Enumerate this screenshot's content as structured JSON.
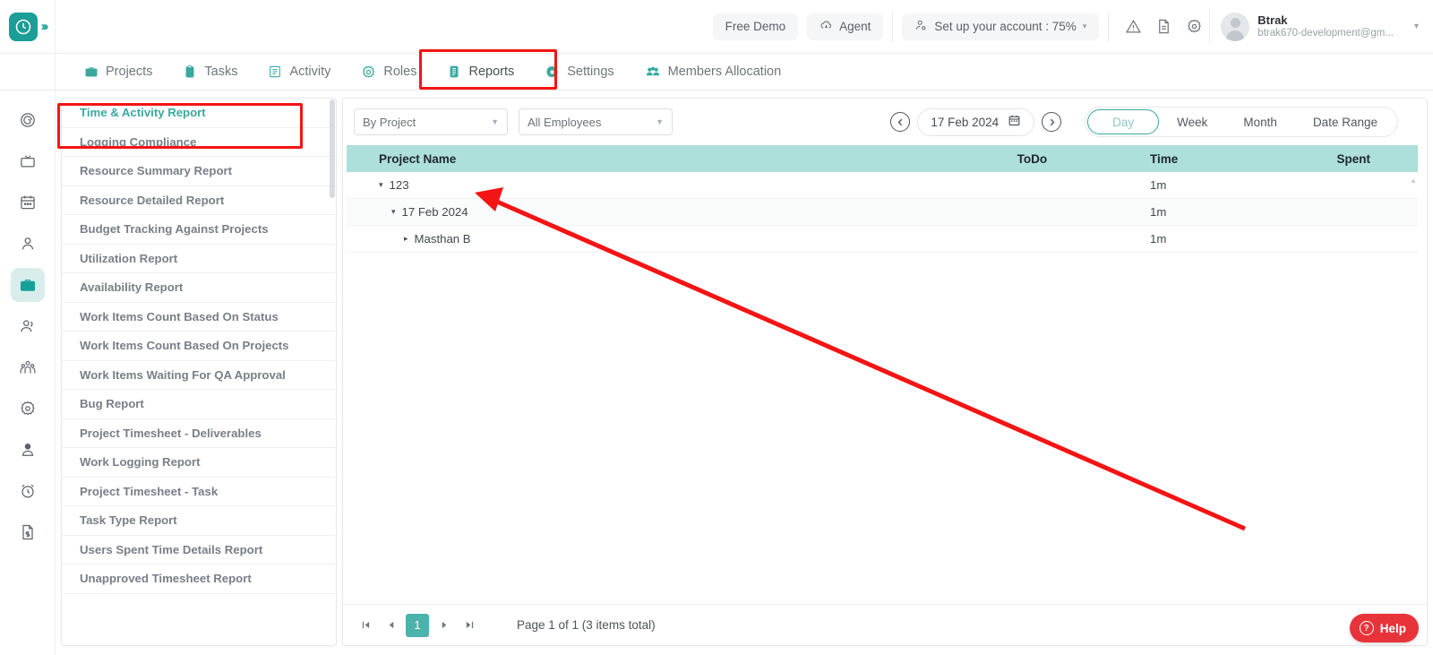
{
  "header": {
    "logo_icon": "clock-logo-icon",
    "expand_icon": "chevrons-right-icon",
    "free_demo_label": "Free Demo",
    "agent_label": "Agent",
    "agent_icon": "cloud-download-icon",
    "setup_label": "Set up your account : 75%",
    "setup_icon": "user-settings-icon",
    "setup_caret": "▾",
    "warning_icon": "warning-triangle-icon",
    "doc_icon": "document-icon",
    "gear_icon": "gear-icon",
    "user_name": "Btrak",
    "user_email": "btrak670-development@gm...",
    "user_caret": "▾",
    "avatar_icon": "avatar-icon"
  },
  "nav": {
    "tabs": [
      {
        "label": "Projects",
        "icon": "briefcase-icon",
        "active": false
      },
      {
        "label": "Tasks",
        "icon": "clipboard-icon",
        "active": false
      },
      {
        "label": "Activity",
        "icon": "list-box-icon",
        "active": false
      },
      {
        "label": "Roles",
        "icon": "gear-circle-icon",
        "active": false
      },
      {
        "label": "Reports",
        "icon": "report-icon",
        "active": true
      },
      {
        "label": "Settings",
        "icon": "settings-gear-icon",
        "active": false
      },
      {
        "label": "Members Allocation",
        "icon": "members-icon",
        "active": false
      }
    ]
  },
  "rail": {
    "items": [
      {
        "icon": "target-spiral-icon",
        "active": false
      },
      {
        "icon": "tv-icon",
        "active": false
      },
      {
        "icon": "calendar-icon",
        "active": false
      },
      {
        "icon": "person-icon",
        "active": false
      },
      {
        "icon": "briefcase-icon",
        "active": true
      },
      {
        "icon": "users-icon",
        "active": false
      },
      {
        "icon": "team-group-icon",
        "active": false
      },
      {
        "icon": "gear-icon",
        "active": false
      },
      {
        "icon": "user-badge-icon",
        "active": false
      },
      {
        "icon": "alarm-clock-icon",
        "active": false
      },
      {
        "icon": "invoice-document-icon",
        "active": false
      }
    ]
  },
  "reports_list": {
    "items": [
      {
        "label": "Time & Activity Report",
        "active": true
      },
      {
        "label": "Logging Compliance",
        "active": false
      },
      {
        "label": "Resource Summary Report",
        "active": false
      },
      {
        "label": "Resource Detailed Report",
        "active": false
      },
      {
        "label": "Budget Tracking Against Projects",
        "active": false
      },
      {
        "label": "Utilization Report",
        "active": false
      },
      {
        "label": "Availability Report",
        "active": false
      },
      {
        "label": "Work Items Count Based On Status",
        "active": false
      },
      {
        "label": "Work Items Count Based On Projects",
        "active": false
      },
      {
        "label": "Work Items Waiting For QA Approval",
        "active": false
      },
      {
        "label": "Bug Report",
        "active": false
      },
      {
        "label": "Project Timesheet - Deliverables",
        "active": false
      },
      {
        "label": "Work Logging Report",
        "active": false
      },
      {
        "label": "Project Timesheet - Task",
        "active": false
      },
      {
        "label": "Task Type Report",
        "active": false
      },
      {
        "label": "Users Spent Time Details Report",
        "active": false
      },
      {
        "label": "Unapproved Timesheet Report",
        "active": false
      }
    ]
  },
  "filters": {
    "group_by": "By Project",
    "employee": "All Employees",
    "prev_icon": "chevron-left-circle-icon",
    "next_icon": "chevron-right-circle-icon",
    "date_value": "17 Feb 2024",
    "calendar_icon": "calendar-icon",
    "range_tabs": [
      {
        "label": "Day",
        "active": true
      },
      {
        "label": "Week",
        "active": false
      },
      {
        "label": "Month",
        "active": false
      },
      {
        "label": "Date Range",
        "active": false
      }
    ]
  },
  "table": {
    "columns": [
      "Project Name",
      "ToDo",
      "Time",
      "Spent"
    ],
    "rows": [
      {
        "name": "123",
        "level": 1,
        "caret": "▾",
        "todo": "",
        "time": "1m",
        "spent": "",
        "alt": false
      },
      {
        "name": "17 Feb 2024",
        "level": 2,
        "caret": "▾",
        "todo": "",
        "time": "1m",
        "spent": "",
        "alt": true
      },
      {
        "name": "Masthan B",
        "level": 3,
        "caret": "▸",
        "todo": "",
        "time": "1m",
        "spent": "",
        "alt": false
      }
    ]
  },
  "pagination": {
    "first_icon": "first-page-icon",
    "prev_icon": "prev-page-icon",
    "current_page": "1",
    "next_icon": "next-page-icon",
    "last_icon": "last-page-icon",
    "summary": "Page 1 of 1 (3 items total)"
  },
  "help": {
    "label": "Help",
    "icon": "question-circle-icon",
    "symbol": "?"
  },
  "colors": {
    "teal": "#3aa8a0",
    "table_header": "#addfdb",
    "pager_active": "#4bb3ab",
    "help_red": "#e8333a",
    "annotation_red": "#f41414"
  }
}
